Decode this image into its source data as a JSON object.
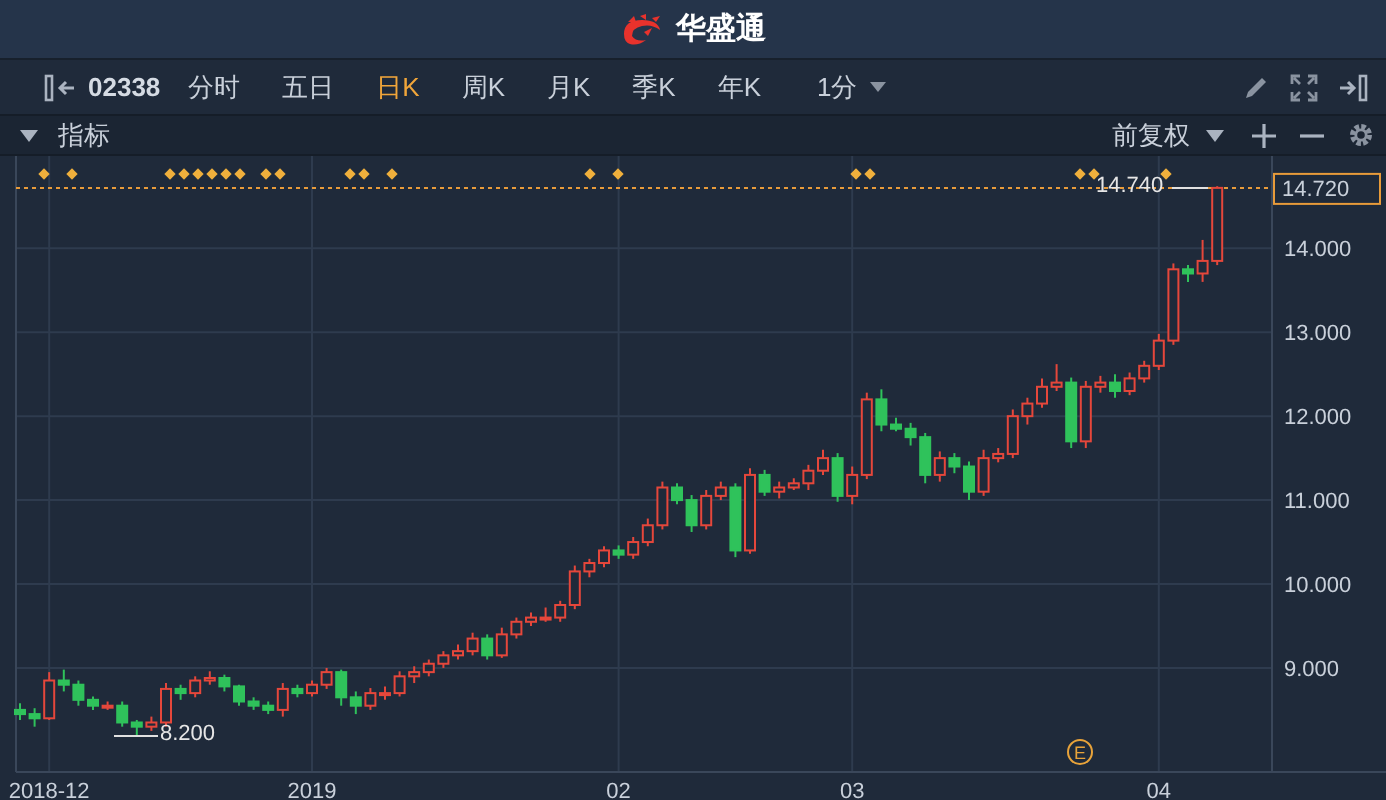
{
  "header": {
    "title": "华盛通"
  },
  "toolbar": {
    "symbol": "02338",
    "periods": [
      {
        "label": "分时",
        "selected": false
      },
      {
        "label": "五日",
        "selected": false
      },
      {
        "label": "日K",
        "selected": true
      },
      {
        "label": "周K",
        "selected": false
      },
      {
        "label": "月K",
        "selected": false
      },
      {
        "label": "季K",
        "selected": false
      },
      {
        "label": "年K",
        "selected": false
      }
    ],
    "interval": "1分"
  },
  "indicator_bar": {
    "label": "指标",
    "adjustment": "前复权"
  },
  "chart": {
    "high_label": "14.740",
    "low_label": "8.200",
    "event_marker": "E",
    "chart_data": {
      "type": "candlestick",
      "grid": true,
      "ref_lines": [
        {
          "axis": "y",
          "value": 14.72,
          "label": "14.720",
          "color": "#e89b3a"
        }
      ],
      "ylim": [
        7.76,
        15.1
      ],
      "categories": [
        null,
        null,
        "2018-12",
        null,
        null,
        null,
        null,
        null,
        null,
        null,
        null,
        null,
        null,
        null,
        null,
        null,
        null,
        null,
        null,
        null,
        "2019",
        null,
        null,
        null,
        null,
        null,
        null,
        null,
        null,
        null,
        null,
        null,
        null,
        null,
        null,
        null,
        null,
        null,
        null,
        null,
        null,
        "02",
        null,
        null,
        null,
        null,
        null,
        null,
        null,
        null,
        null,
        null,
        null,
        null,
        null,
        null,
        null,
        "03",
        null,
        null,
        null,
        null,
        null,
        null,
        null,
        null,
        null,
        null,
        null,
        null,
        null,
        null,
        null,
        null,
        null,
        null,
        null,
        null,
        "04",
        null,
        null,
        null,
        null
      ],
      "yticks": [
        {
          "value": 14,
          "label": "14.000"
        },
        {
          "value": 13,
          "label": "13.000"
        },
        {
          "value": 12,
          "label": "12.000"
        },
        {
          "value": 11,
          "label": "11.000"
        },
        {
          "value": 10,
          "label": "10.000"
        },
        {
          "value": 9,
          "label": "9.000"
        }
      ],
      "ohlc": [
        [
          8.5,
          8.58,
          8.38,
          8.45
        ],
        [
          8.45,
          8.52,
          8.3,
          8.4
        ],
        [
          8.4,
          8.95,
          8.38,
          8.85
        ],
        [
          8.85,
          8.98,
          8.72,
          8.8
        ],
        [
          8.8,
          8.85,
          8.55,
          8.62
        ],
        [
          8.62,
          8.66,
          8.5,
          8.55
        ],
        [
          8.55,
          8.6,
          8.5,
          8.55
        ],
        [
          8.55,
          8.6,
          8.3,
          8.35
        ],
        [
          8.35,
          8.38,
          8.2,
          8.3
        ],
        [
          8.3,
          8.42,
          8.25,
          8.35
        ],
        [
          8.35,
          8.82,
          8.3,
          8.75
        ],
        [
          8.75,
          8.8,
          8.62,
          8.7
        ],
        [
          8.7,
          8.9,
          8.65,
          8.85
        ],
        [
          8.85,
          8.96,
          8.8,
          8.88
        ],
        [
          8.88,
          8.92,
          8.72,
          8.78
        ],
        [
          8.78,
          8.8,
          8.55,
          8.6
        ],
        [
          8.6,
          8.65,
          8.5,
          8.55
        ],
        [
          8.55,
          8.6,
          8.45,
          8.5
        ],
        [
          8.5,
          8.82,
          8.42,
          8.75
        ],
        [
          8.75,
          8.8,
          8.65,
          8.7
        ],
        [
          8.7,
          8.85,
          8.66,
          8.8
        ],
        [
          8.8,
          9.0,
          8.75,
          8.95
        ],
        [
          8.95,
          8.98,
          8.55,
          8.65
        ],
        [
          8.65,
          8.72,
          8.45,
          8.55
        ],
        [
          8.55,
          8.76,
          8.5,
          8.7
        ],
        [
          8.7,
          8.78,
          8.62,
          8.7
        ],
        [
          8.7,
          8.96,
          8.66,
          8.9
        ],
        [
          8.9,
          9.02,
          8.82,
          8.95
        ],
        [
          8.95,
          9.1,
          8.9,
          9.05
        ],
        [
          9.05,
          9.2,
          9.0,
          9.15
        ],
        [
          9.15,
          9.28,
          9.1,
          9.2
        ],
        [
          9.2,
          9.42,
          9.15,
          9.35
        ],
        [
          9.35,
          9.4,
          9.1,
          9.15
        ],
        [
          9.15,
          9.48,
          9.12,
          9.4
        ],
        [
          9.4,
          9.6,
          9.35,
          9.55
        ],
        [
          9.55,
          9.66,
          9.5,
          9.6
        ],
        [
          9.6,
          9.72,
          9.55,
          9.6
        ],
        [
          9.6,
          9.8,
          9.55,
          9.75
        ],
        [
          9.75,
          10.22,
          9.7,
          10.15
        ],
        [
          10.15,
          10.3,
          10.08,
          10.25
        ],
        [
          10.25,
          10.45,
          10.2,
          10.4
        ],
        [
          10.4,
          10.46,
          10.3,
          10.35
        ],
        [
          10.35,
          10.56,
          10.3,
          10.5
        ],
        [
          10.5,
          10.78,
          10.45,
          10.7
        ],
        [
          10.7,
          11.22,
          10.65,
          11.15
        ],
        [
          11.15,
          11.2,
          10.95,
          11.0
        ],
        [
          11.0,
          11.06,
          10.62,
          10.7
        ],
        [
          10.7,
          11.12,
          10.65,
          11.05
        ],
        [
          11.05,
          11.22,
          11.0,
          11.15
        ],
        [
          11.15,
          11.2,
          10.32,
          10.4
        ],
        [
          10.4,
          11.38,
          10.36,
          11.3
        ],
        [
          11.3,
          11.36,
          11.05,
          11.1
        ],
        [
          11.1,
          11.22,
          11.02,
          11.15
        ],
        [
          11.15,
          11.26,
          11.12,
          11.2
        ],
        [
          11.2,
          11.42,
          11.12,
          11.35
        ],
        [
          11.35,
          11.6,
          11.3,
          11.5
        ],
        [
          11.5,
          11.56,
          10.98,
          11.05
        ],
        [
          11.05,
          11.4,
          10.95,
          11.3
        ],
        [
          11.3,
          12.28,
          11.25,
          12.2
        ],
        [
          12.2,
          12.32,
          11.82,
          11.9
        ],
        [
          11.9,
          11.98,
          11.82,
          11.85
        ],
        [
          11.85,
          11.92,
          11.65,
          11.75
        ],
        [
          11.75,
          11.8,
          11.2,
          11.3
        ],
        [
          11.3,
          11.58,
          11.22,
          11.5
        ],
        [
          11.5,
          11.56,
          11.32,
          11.4
        ],
        [
          11.4,
          11.46,
          11.0,
          11.1
        ],
        [
          11.1,
          11.6,
          11.05,
          11.5
        ],
        [
          11.5,
          11.62,
          11.45,
          11.55
        ],
        [
          11.55,
          12.08,
          11.5,
          12.0
        ],
        [
          12.0,
          12.22,
          11.9,
          12.15
        ],
        [
          12.15,
          12.45,
          12.1,
          12.35
        ],
        [
          12.35,
          12.62,
          12.3,
          12.4
        ],
        [
          12.4,
          12.46,
          11.62,
          11.7
        ],
        [
          11.7,
          12.42,
          11.62,
          12.35
        ],
        [
          12.35,
          12.48,
          12.28,
          12.4
        ],
        [
          12.4,
          12.5,
          12.22,
          12.3
        ],
        [
          12.3,
          12.52,
          12.25,
          12.45
        ],
        [
          12.45,
          12.66,
          12.4,
          12.6
        ],
        [
          12.6,
          12.98,
          12.55,
          12.9
        ],
        [
          12.9,
          13.82,
          12.85,
          13.75
        ],
        [
          13.75,
          13.8,
          13.6,
          13.7
        ],
        [
          13.7,
          14.1,
          13.6,
          13.85
        ],
        [
          13.85,
          14.74,
          13.8,
          14.72
        ]
      ]
    }
  }
}
